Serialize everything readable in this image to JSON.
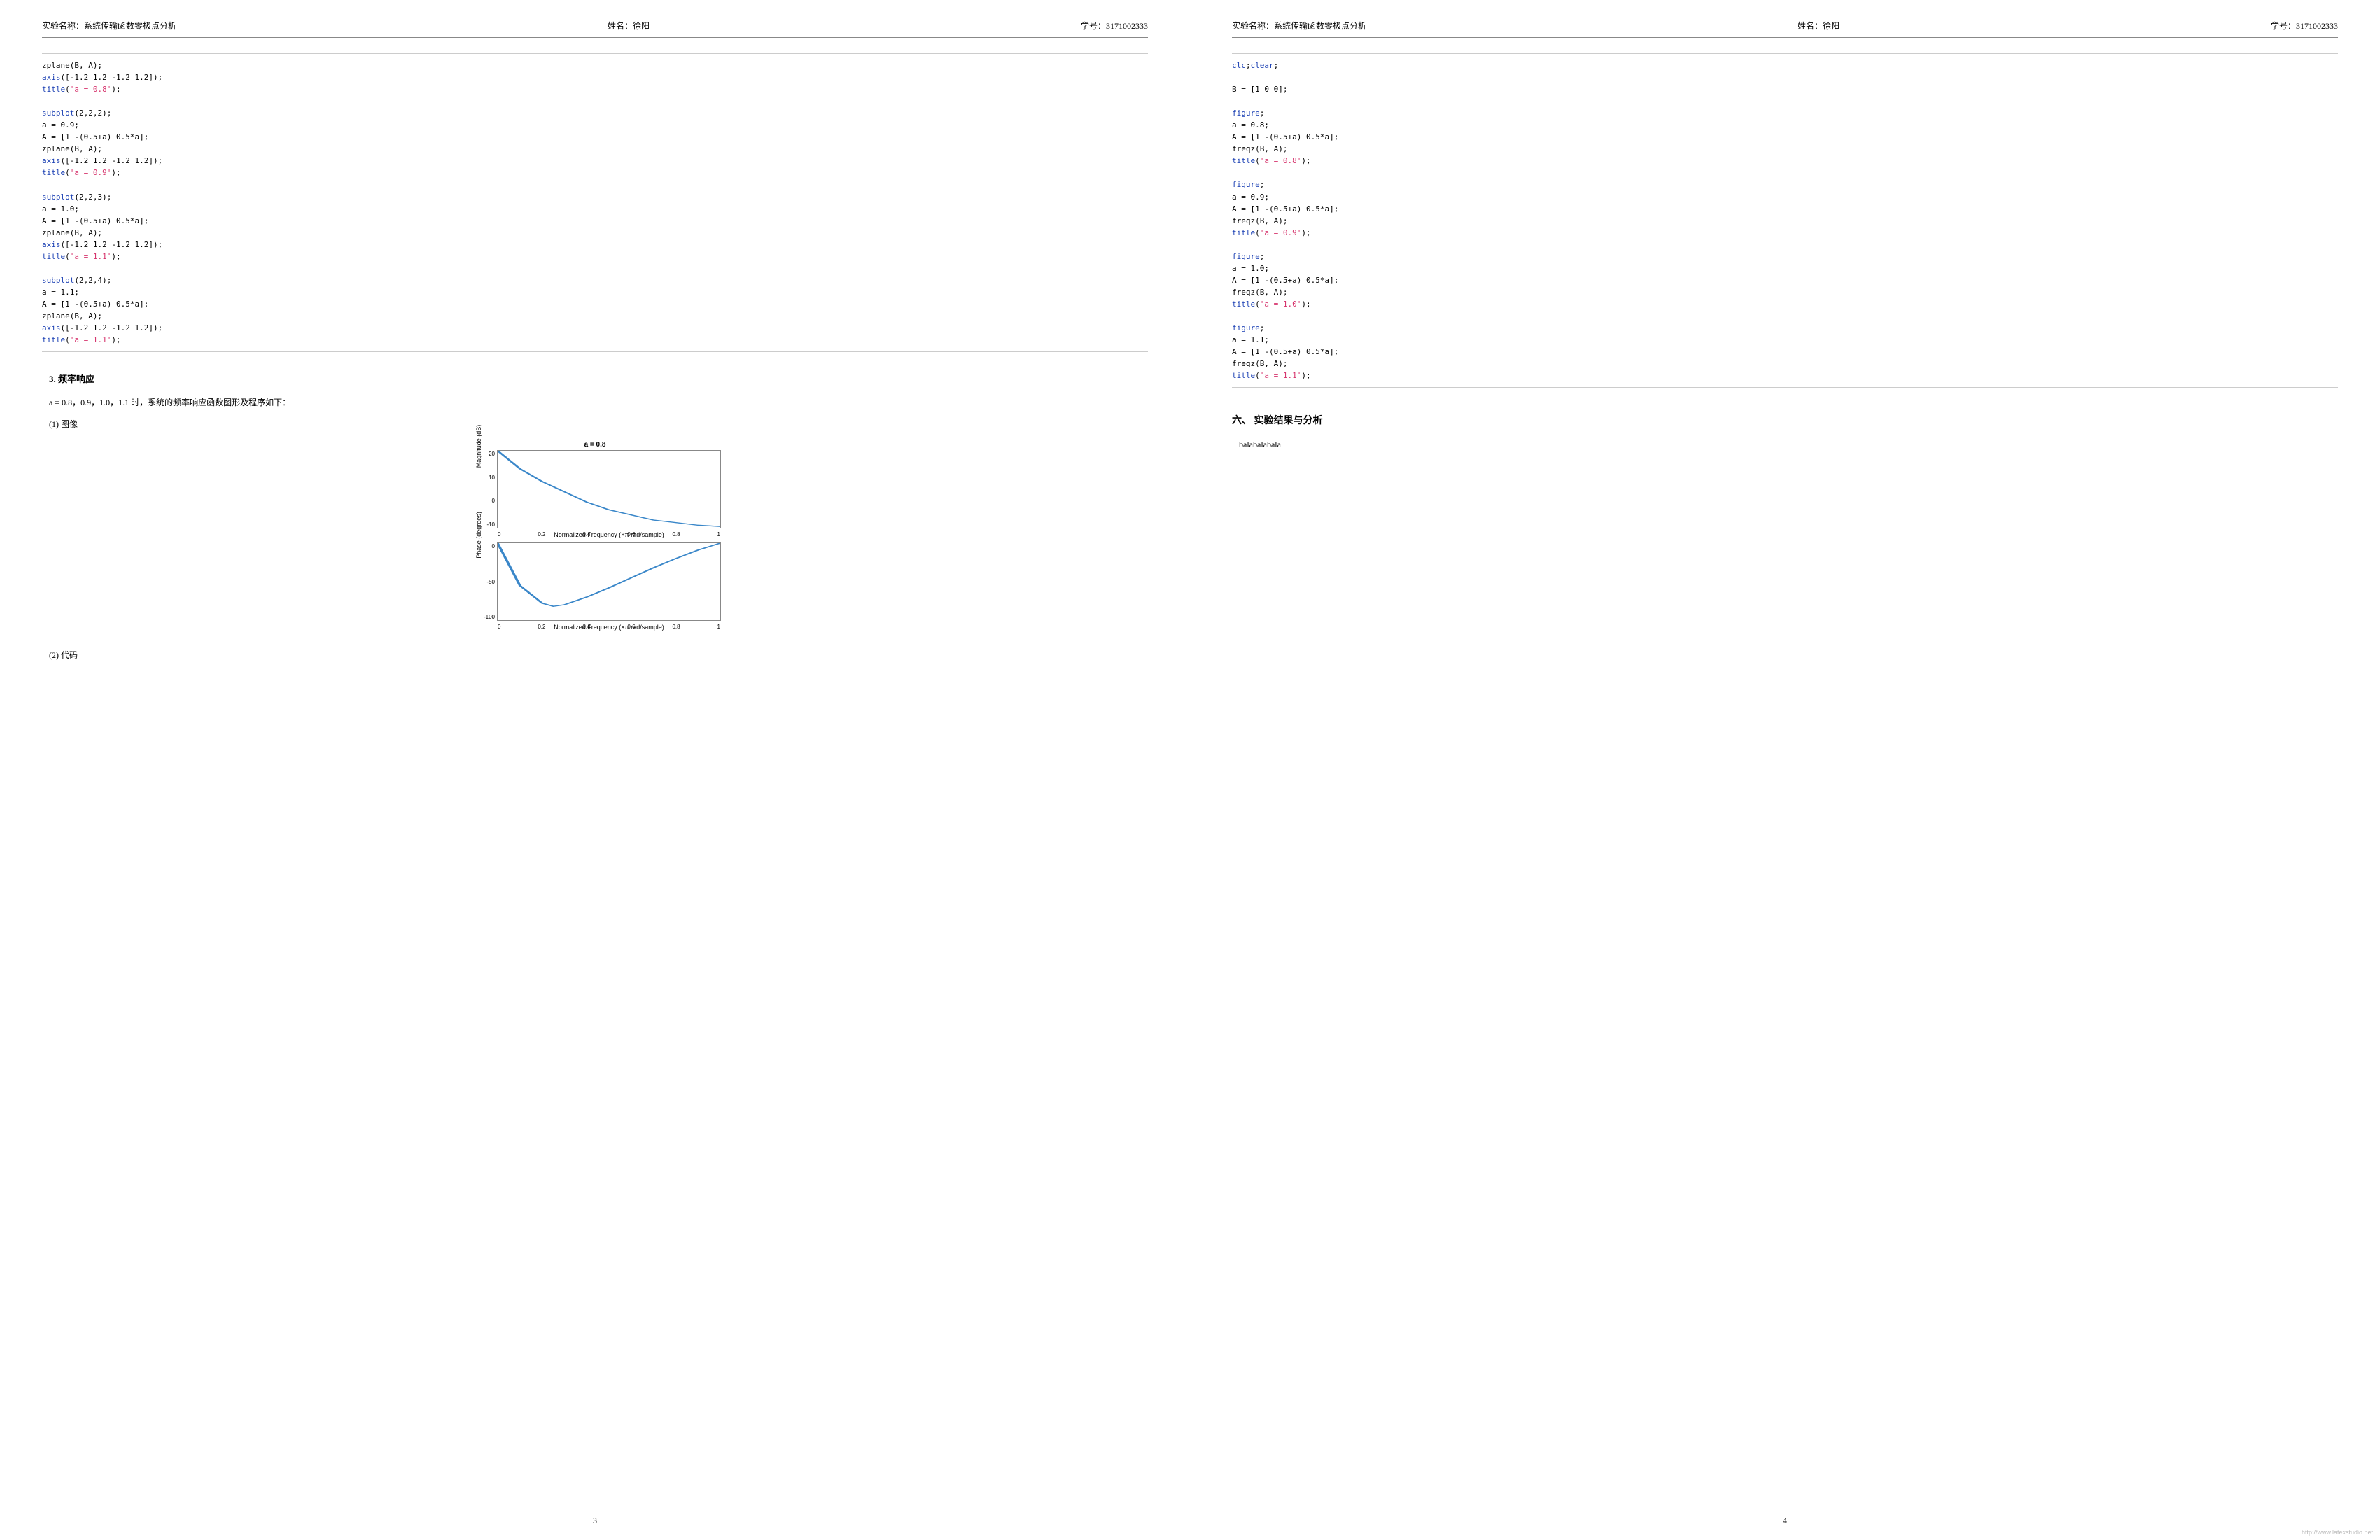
{
  "header": {
    "experiment_label": "实验名称：系统传输函数零极点分析",
    "name_label": "姓名：徐阳",
    "id_label": "学号：3171002333"
  },
  "page_left": {
    "page_number": "3",
    "section_3": "3.   频率响应",
    "freq_intro": "a = 0.8，0.9，1.0，1.1 时，系统的频率响应函数图形及程序如下：",
    "item_1": "(1) 图像",
    "item_2": "(2) 代码"
  },
  "page_right": {
    "page_number": "4",
    "section_6": "六、   实验结果与分析",
    "placeholder": "balabalabala",
    "watermark": "http://www.latexstudio.net"
  },
  "code_left": {
    "lines": [
      {
        "t": "zplane(B, A);"
      },
      {
        "t": "axis([-1.2 1.2 -1.2 1.2]);",
        "fn": "axis"
      },
      {
        "t": "title('a = 0.8');",
        "fn": "title",
        "str": "'a = 0.8'"
      },
      {
        "t": ""
      },
      {
        "t": "subplot(2,2,2);",
        "fn": "subplot"
      },
      {
        "t": "a = 0.9;"
      },
      {
        "t": "A = [1 -(0.5+a) 0.5*a];"
      },
      {
        "t": "zplane(B, A);"
      },
      {
        "t": "axis([-1.2 1.2 -1.2 1.2]);",
        "fn": "axis"
      },
      {
        "t": "title('a = 0.9');",
        "fn": "title",
        "str": "'a = 0.9'"
      },
      {
        "t": ""
      },
      {
        "t": "subplot(2,2,3);",
        "fn": "subplot"
      },
      {
        "t": "a = 1.0;"
      },
      {
        "t": "A = [1 -(0.5+a) 0.5*a];"
      },
      {
        "t": "zplane(B, A);"
      },
      {
        "t": "axis([-1.2 1.2 -1.2 1.2]);",
        "fn": "axis"
      },
      {
        "t": "title('a = 1.1');",
        "fn": "title",
        "str": "'a = 1.1'"
      },
      {
        "t": ""
      },
      {
        "t": "subplot(2,2,4);",
        "fn": "subplot"
      },
      {
        "t": "a = 1.1;"
      },
      {
        "t": "A = [1 -(0.5+a) 0.5*a];"
      },
      {
        "t": "zplane(B, A);"
      },
      {
        "t": "axis([-1.2 1.2 -1.2 1.2]);",
        "fn": "axis"
      },
      {
        "t": "title('a = 1.1');",
        "fn": "title",
        "str": "'a = 1.1'"
      }
    ]
  },
  "code_right": {
    "lines": [
      {
        "t": "clc;clear;",
        "fn": "clc",
        "fn2": "clear"
      },
      {
        "t": ""
      },
      {
        "t": "B = [1 0 0];"
      },
      {
        "t": ""
      },
      {
        "t": "figure;",
        "fn": "figure"
      },
      {
        "t": "a = 0.8;"
      },
      {
        "t": "A = [1 -(0.5+a) 0.5*a];"
      },
      {
        "t": "freqz(B, A);"
      },
      {
        "t": "title('a = 0.8');",
        "fn": "title",
        "str": "'a = 0.8'"
      },
      {
        "t": ""
      },
      {
        "t": "figure;",
        "fn": "figure"
      },
      {
        "t": "a = 0.9;"
      },
      {
        "t": "A = [1 -(0.5+a) 0.5*a];"
      },
      {
        "t": "freqz(B, A);"
      },
      {
        "t": "title('a = 0.9');",
        "fn": "title",
        "str": "'a = 0.9'"
      },
      {
        "t": ""
      },
      {
        "t": "figure;",
        "fn": "figure"
      },
      {
        "t": "a = 1.0;"
      },
      {
        "t": "A = [1 -(0.5+a) 0.5*a];"
      },
      {
        "t": "freqz(B, A);"
      },
      {
        "t": "title('a = 1.0');",
        "fn": "title",
        "str": "'a = 1.0'"
      },
      {
        "t": ""
      },
      {
        "t": "figure;",
        "fn": "figure"
      },
      {
        "t": "a = 1.1;"
      },
      {
        "t": "A = [1 -(0.5+a) 0.5*a];"
      },
      {
        "t": "freqz(B, A);"
      },
      {
        "t": "title('a = 1.1');",
        "fn": "title",
        "str": "'a = 1.1'"
      }
    ]
  },
  "chart_data": [
    {
      "type": "line",
      "title": "a = 0.8",
      "xlabel": "Normalized Frequency (×π rad/sample)",
      "ylabel": "Magnitude (dB)",
      "xlim": [
        0,
        1
      ],
      "ylim": [
        -10,
        20
      ],
      "xticks": [
        0,
        0.2,
        0.4,
        0.6,
        0.8,
        1
      ],
      "yticks": [
        20,
        10,
        0,
        -10
      ],
      "series": [
        {
          "name": "magnitude",
          "x": [
            0,
            0.1,
            0.2,
            0.3,
            0.4,
            0.5,
            0.6,
            0.7,
            0.8,
            0.9,
            1.0
          ],
          "y": [
            20,
            13,
            8,
            4,
            0,
            -3,
            -5,
            -7,
            -8,
            -9,
            -9.5
          ]
        }
      ]
    },
    {
      "type": "line",
      "title": "",
      "xlabel": "Normalized Frequency (×π rad/sample)",
      "ylabel": "Phase (degrees)",
      "xlim": [
        0,
        1
      ],
      "ylim": [
        -100,
        0
      ],
      "xticks": [
        0,
        0.2,
        0.4,
        0.6,
        0.8,
        1
      ],
      "yticks": [
        0,
        -50,
        -100
      ],
      "series": [
        {
          "name": "phase",
          "x": [
            0,
            0.1,
            0.2,
            0.25,
            0.3,
            0.4,
            0.5,
            0.6,
            0.7,
            0.8,
            0.9,
            1.0
          ],
          "y": [
            0,
            -55,
            -78,
            -82,
            -80,
            -70,
            -58,
            -45,
            -32,
            -20,
            -9,
            0
          ]
        }
      ]
    }
  ]
}
